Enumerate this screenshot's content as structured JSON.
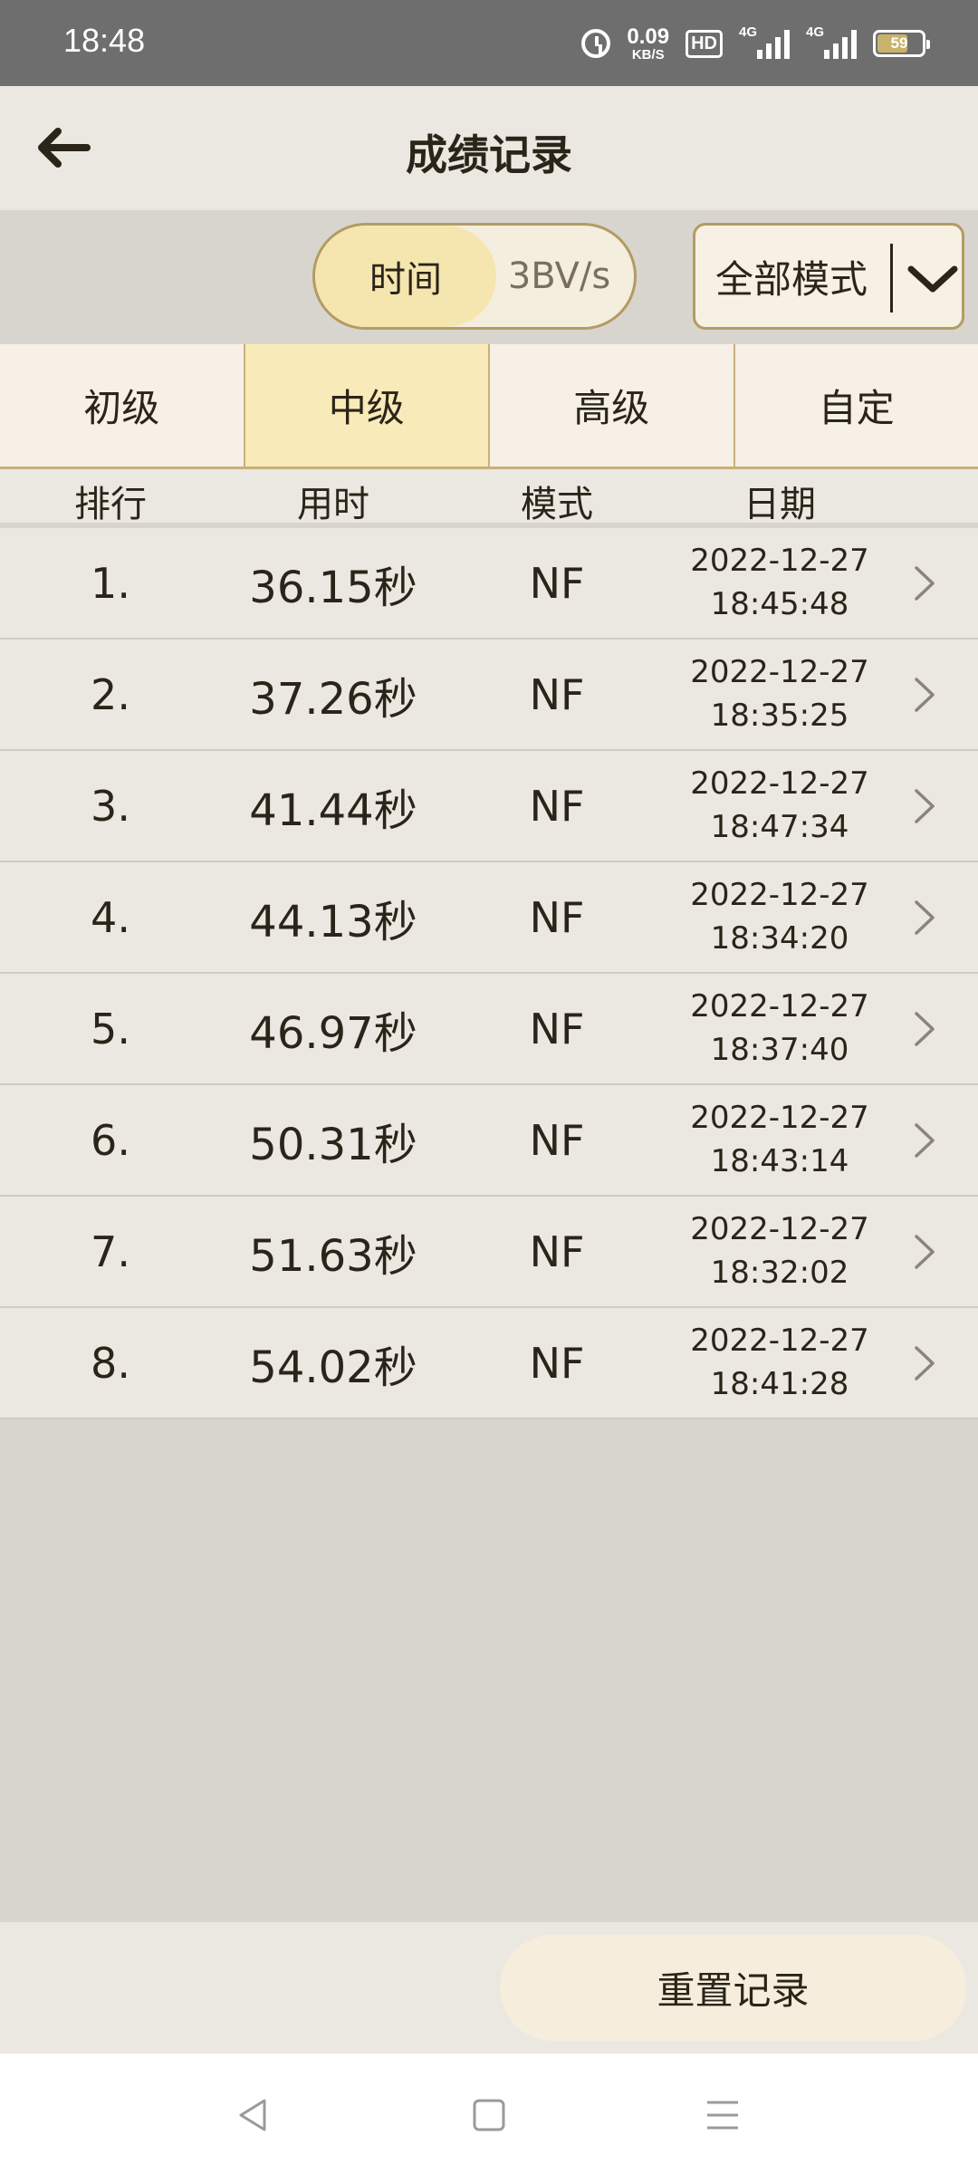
{
  "status_bar": {
    "time": "18:48",
    "net_speed_value": "0.09",
    "net_speed_unit": "KB/S",
    "hd_label": "HD",
    "sim1_label": "4G",
    "sim2_label": "4G",
    "battery_percent": "59",
    "icons": [
      "alarm-icon",
      "hd-icon",
      "signal-icon",
      "signal-icon",
      "battery-icon"
    ]
  },
  "header": {
    "title": "成绩记录",
    "back_icon": "arrow-left-icon"
  },
  "sort_toggle": {
    "options": [
      "时间",
      "3BV/s"
    ],
    "selected": "时间"
  },
  "mode_select": {
    "value": "全部模式",
    "icon": "chevron-down-icon"
  },
  "level_tabs": {
    "items": [
      "初级",
      "中级",
      "高级",
      "自定"
    ],
    "active": "中级"
  },
  "table": {
    "headers": [
      "排行",
      "用时",
      "模式",
      "日期"
    ],
    "rows": [
      {
        "rank": "1.",
        "time": "36.15秒",
        "mode": "NF",
        "date": "2022-12-27",
        "clock": "18:45:48"
      },
      {
        "rank": "2.",
        "time": "37.26秒",
        "mode": "NF",
        "date": "2022-12-27",
        "clock": "18:35:25"
      },
      {
        "rank": "3.",
        "time": "41.44秒",
        "mode": "NF",
        "date": "2022-12-27",
        "clock": "18:47:34"
      },
      {
        "rank": "4.",
        "time": "44.13秒",
        "mode": "NF",
        "date": "2022-12-27",
        "clock": "18:34:20"
      },
      {
        "rank": "5.",
        "time": "46.97秒",
        "mode": "NF",
        "date": "2022-12-27",
        "clock": "18:37:40"
      },
      {
        "rank": "6.",
        "time": "50.31秒",
        "mode": "NF",
        "date": "2022-12-27",
        "clock": "18:43:14"
      },
      {
        "rank": "7.",
        "time": "51.63秒",
        "mode": "NF",
        "date": "2022-12-27",
        "clock": "18:32:02"
      },
      {
        "rank": "8.",
        "time": "54.02秒",
        "mode": "NF",
        "date": "2022-12-27",
        "clock": "18:41:28"
      }
    ],
    "row_icon": "chevron-right-icon"
  },
  "footer": {
    "reset_label": "重置记录"
  },
  "nav": {
    "icons": [
      "back-triangle-icon",
      "home-square-icon",
      "menu-lines-icon"
    ]
  },
  "colors": {
    "accent_border": "#b39b62",
    "active_fill": "#f8ebb9",
    "row_bg": "#ebe8e1",
    "page_bg": "#d9d6cf",
    "text": "#2b2418"
  }
}
